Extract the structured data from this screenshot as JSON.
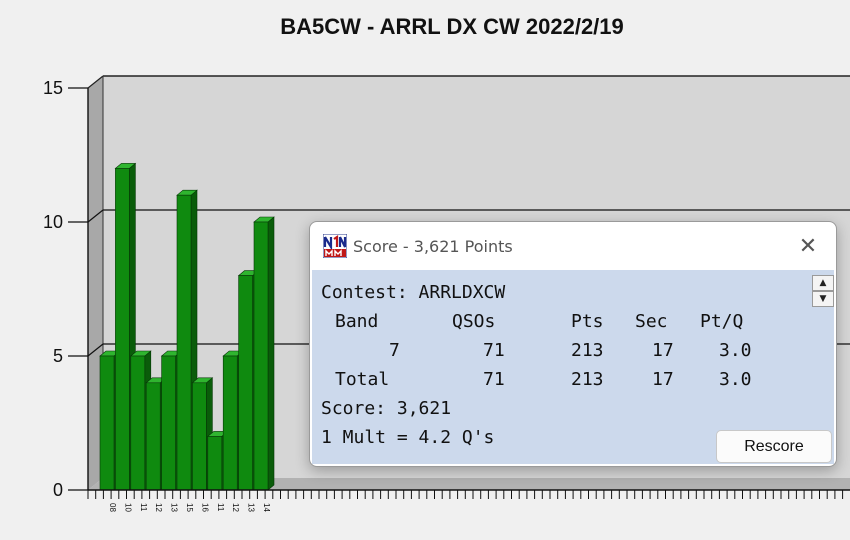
{
  "chart_data": {
    "type": "bar",
    "title": "BA5CW - ARRL DX CW 2022/2/19",
    "xlabel": "",
    "ylabel": "",
    "ylim": [
      0,
      15
    ],
    "yticks": [
      0,
      5,
      10,
      15
    ],
    "grid": true,
    "categories": [
      "08",
      "10",
      "11",
      "12",
      "13",
      "15",
      "16",
      "11",
      "12",
      "13",
      "14"
    ],
    "values": [
      5,
      12,
      5,
      4,
      5,
      11,
      4,
      2,
      5,
      8,
      10
    ],
    "bar_color": "#0f8a0f"
  },
  "score_window": {
    "title": "Score - 3,621 Points",
    "close_glyph": "✕",
    "scroll_up_glyph": "▲",
    "scroll_down_glyph": "▼",
    "contest_line": "Contest: ARRLDXCW",
    "table": {
      "headers": [
        "Band",
        "QSOs",
        "Pts",
        "Sec",
        "Pt/Q"
      ],
      "rows": [
        [
          "7",
          "71",
          "213",
          "17",
          "3.0"
        ],
        [
          "Total",
          "71",
          "213",
          "17",
          "3.0"
        ]
      ]
    },
    "score_line": "Score: 3,621",
    "mult_line": "1 Mult = 4.2 Q's",
    "rescore_label": "Rescore"
  }
}
